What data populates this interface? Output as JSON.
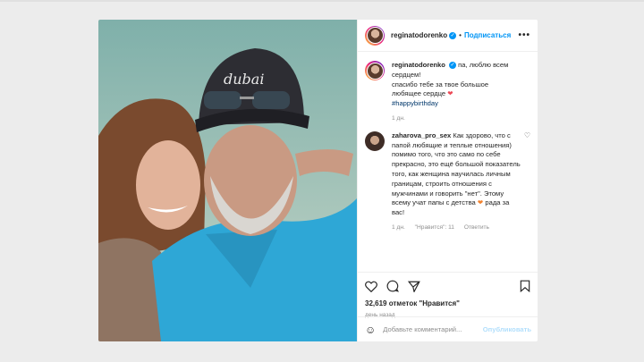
{
  "header": {
    "username": "reginatodorenko",
    "follow_label": "Подписаться",
    "dot": "•",
    "more": "•••"
  },
  "caption": {
    "username": "reginatodorenko",
    "text_line1": "па, люблю всем",
    "text_line2": "сердцем!",
    "text_line3": "спасибо тебе за твое большое",
    "text_line4": "любящее сердце",
    "hashtag": "#happybirthday",
    "time": "1 дн."
  },
  "comment": {
    "username": "zaharova_pro_sex",
    "text": "Как здорово, что с папой любящие и теплые отношения) помимо того, что это само по себе прекрасно, это ещё большой показатель того, как женщина научилась личным границам, строить отношения с мужчинами и говорить \"нет\". Этому всему учат папы с детства",
    "text_end": "рада за вас!",
    "time": "1 дн.",
    "likes": "\"Нравится\": 11",
    "reply": "Ответить"
  },
  "post": {
    "likes": "32,619 отметок \"Нравится\"",
    "time_ago": "день назад"
  },
  "add_comment": {
    "placeholder": "Добавьте комментарий...",
    "publish": "Опубликовать"
  },
  "photo": {
    "cap_text": "dubai"
  },
  "colors": {
    "accent": "#0095f6",
    "heart": "#ed4956",
    "shirt": "#2ea7d6"
  }
}
